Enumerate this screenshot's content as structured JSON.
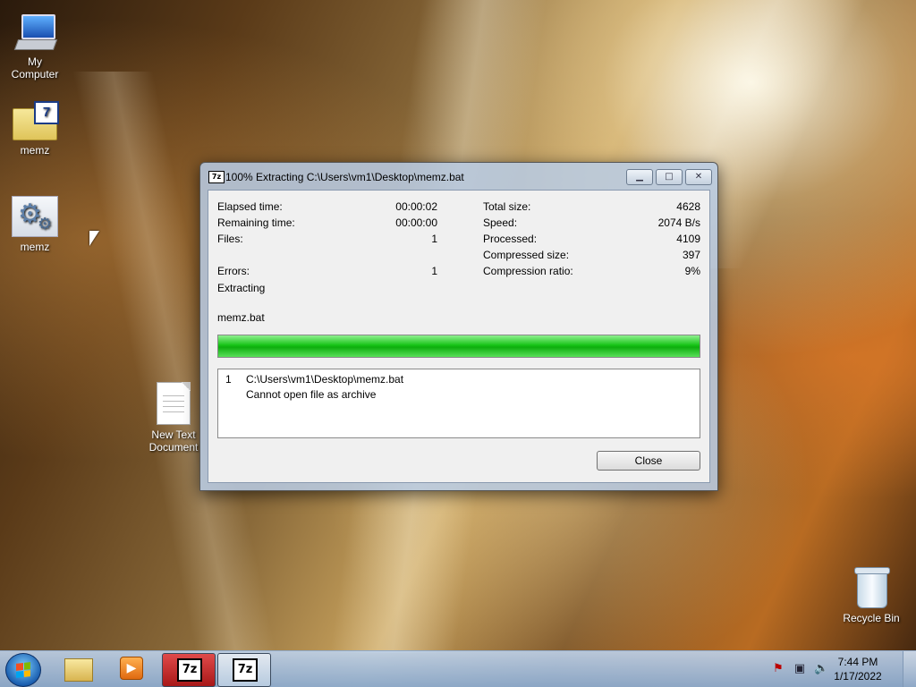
{
  "desktop": {
    "icons": [
      {
        "label": "My Computer"
      },
      {
        "label": "memz"
      },
      {
        "label": "memz"
      },
      {
        "label": "New Text Document"
      },
      {
        "label": "Recycle Bin"
      }
    ]
  },
  "dialog": {
    "title": "100% Extracting C:\\Users\\vm1\\Desktop\\memz.bat",
    "app_icon": "7z",
    "stats_left": [
      {
        "label": "Elapsed time:",
        "value": "00:00:02"
      },
      {
        "label": "Remaining time:",
        "value": "00:00:00"
      },
      {
        "label": "Files:",
        "value": "1"
      },
      {
        "label": "Errors:",
        "value": "1"
      }
    ],
    "stats_right": [
      {
        "label": "Total size:",
        "value": "4628"
      },
      {
        "label": "Speed:",
        "value": "2074 B/s"
      },
      {
        "label": "Processed:",
        "value": "4109"
      },
      {
        "label": "Compressed size:",
        "value": "397"
      },
      {
        "label": "Compression ratio:",
        "value": "9%"
      }
    ],
    "status": "Extracting",
    "current_file": "memz.bat",
    "progress_percent": 100,
    "log": {
      "number": "1",
      "path": "C:\\Users\\vm1\\Desktop\\memz.bat",
      "message": "Cannot open file as archive"
    },
    "close_label": "Close"
  },
  "taskbar": {
    "items": [
      "start-orb-icon",
      "explorer-folder-icon",
      "media-player-icon",
      "7zip-icon",
      "7zip-icon"
    ],
    "clock_time": "7:44 PM",
    "clock_date": "1/17/2022",
    "tray_icons": [
      "action-center-flag-icon",
      "network-icon",
      "volume-icon"
    ]
  },
  "colors": {
    "progress_green": "#17c417",
    "active_task_red": "#c02020"
  }
}
